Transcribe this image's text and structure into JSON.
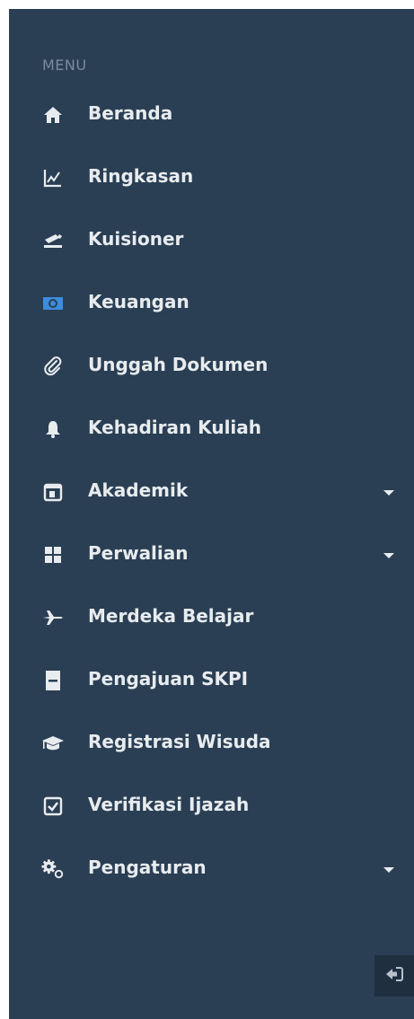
{
  "sidebar": {
    "menu_label": "MENU",
    "items": [
      {
        "label": "Beranda",
        "icon": "home-icon"
      },
      {
        "label": "Ringkasan",
        "icon": "line-chart-icon"
      },
      {
        "label": "Kuisioner",
        "icon": "questionnaire-icon"
      },
      {
        "label": "Keuangan",
        "icon": "money-icon"
      },
      {
        "label": "Unggah Dokumen",
        "icon": "paperclip-icon"
      },
      {
        "label": "Kehadiran Kuliah",
        "icon": "bell-icon"
      },
      {
        "label": "Akademik",
        "icon": "calendar-icon",
        "has_submenu": true
      },
      {
        "label": "Perwalian",
        "icon": "grid-icon",
        "has_submenu": true
      },
      {
        "label": "Merdeka Belajar",
        "icon": "plane-icon"
      },
      {
        "label": "Pengajuan SKPI",
        "icon": "document-icon"
      },
      {
        "label": "Registrasi Wisuda",
        "icon": "graduation-cap-icon"
      },
      {
        "label": "Verifikasi Ijazah",
        "icon": "check-square-icon"
      },
      {
        "label": "Pengaturan",
        "icon": "gears-icon",
        "has_submenu": true
      }
    ]
  },
  "colors": {
    "sidebar_bg": "#2a3f54",
    "text": "#e8ecef",
    "menu_label": "#7a8b9c",
    "money_icon": "#3c8dde"
  }
}
